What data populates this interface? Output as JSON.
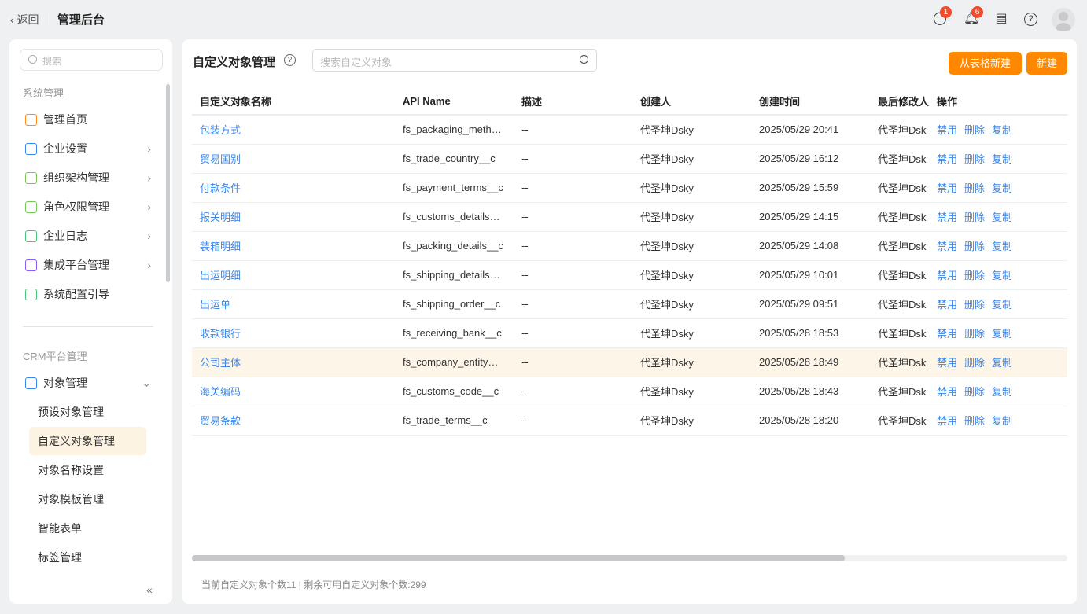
{
  "topbar": {
    "back": "返回",
    "title": "管理后台",
    "message_badge": "1",
    "notify_badge": "6"
  },
  "sidebar": {
    "search_placeholder": "搜索",
    "section1": "系统管理",
    "items": [
      {
        "label": "管理首页",
        "color": "#ff8a1f"
      },
      {
        "label": "企业设置",
        "color": "#3d86e8"
      },
      {
        "label": "组织架构管理",
        "color": "#7cc45a"
      },
      {
        "label": "角色权限管理",
        "color": "#7cc45a"
      },
      {
        "label": "企业日志",
        "color": "#4cc27a"
      },
      {
        "label": "集成平台管理",
        "color": "#8b5cf6"
      },
      {
        "label": "系统配置引导",
        "color": "#4cc27a"
      }
    ],
    "section2": "CRM平台管理",
    "object_mgmt": "对象管理",
    "subitems": [
      "预设对象管理",
      "自定义对象管理",
      "对象名称设置",
      "对象模板管理",
      "智能表单",
      "标签管理"
    ],
    "active_sub": "自定义对象管理"
  },
  "main": {
    "title": "自定义对象管理",
    "search_placeholder": "搜索自定义对象",
    "btn_from_table": "从表格新建",
    "btn_new": "新建",
    "columns": [
      "自定义对象名称",
      "API Name",
      "描述",
      "创建人",
      "创建时间",
      "最后修改人",
      "操作"
    ],
    "actions": [
      "禁用",
      "删除",
      "复制"
    ],
    "rows": [
      [
        "包装方式",
        "fs_packaging_meth…",
        "--",
        "代圣坤Dsky",
        "2025/05/29 20:41",
        "代圣坤Dsk"
      ],
      [
        "贸易国别",
        "fs_trade_country__c",
        "--",
        "代圣坤Dsky",
        "2025/05/29 16:12",
        "代圣坤Dsk"
      ],
      [
        "付款条件",
        "fs_payment_terms__c",
        "--",
        "代圣坤Dsky",
        "2025/05/29 15:59",
        "代圣坤Dsk"
      ],
      [
        "报关明细",
        "fs_customs_details…",
        "--",
        "代圣坤Dsky",
        "2025/05/29 14:15",
        "代圣坤Dsk"
      ],
      [
        "装箱明细",
        "fs_packing_details__c",
        "--",
        "代圣坤Dsky",
        "2025/05/29 14:08",
        "代圣坤Dsk"
      ],
      [
        "出运明细",
        "fs_shipping_details…",
        "--",
        "代圣坤Dsky",
        "2025/05/29 10:01",
        "代圣坤Dsk"
      ],
      [
        "出运单",
        "fs_shipping_order__c",
        "--",
        "代圣坤Dsky",
        "2025/05/29 09:51",
        "代圣坤Dsk"
      ],
      [
        "收款银行",
        "fs_receiving_bank__c",
        "--",
        "代圣坤Dsky",
        "2025/05/28 18:53",
        "代圣坤Dsk"
      ],
      [
        "公司主体",
        "fs_company_entity…",
        "--",
        "代圣坤Dsky",
        "2025/05/28 18:49",
        "代圣坤Dsk"
      ],
      [
        "海关编码",
        "fs_customs_code__c",
        "--",
        "代圣坤Dsky",
        "2025/05/28 18:43",
        "代圣坤Dsk"
      ],
      [
        "贸易条款",
        "fs_trade_terms__c",
        "--",
        "代圣坤Dsky",
        "2025/05/28 18:20",
        "代圣坤Dsk"
      ]
    ],
    "highlighted_row": 8,
    "footer": "当前自定义对象个数11  |  剩余可用自定义对象个数:299"
  }
}
